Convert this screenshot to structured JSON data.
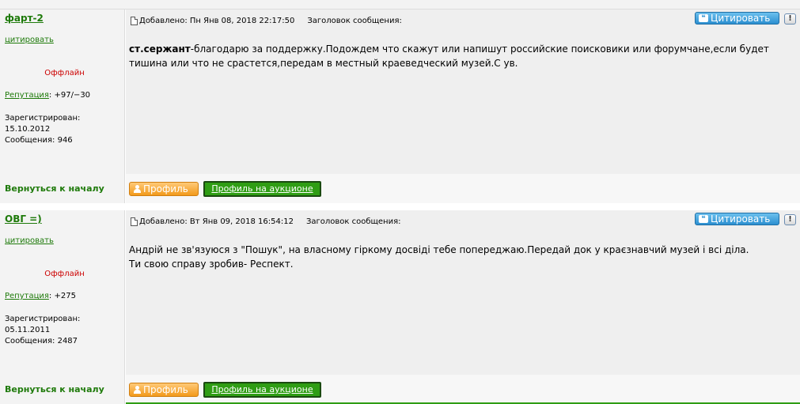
{
  "common": {
    "added_label": "Добавлено:",
    "subject_label": "Заголовок сообщения:",
    "quote_link": "цитировать",
    "cite_button": "Цитировать",
    "report_button": "!",
    "reputation_label": "Репутация",
    "registered_label": "Зарегистрирован:",
    "messages_label": "Сообщения:",
    "back_to_top": "Вернуться к началу",
    "profile_button": "Профиль",
    "auction_button": "Профиль на аукционе"
  },
  "posts": [
    {
      "username": "фарт-2",
      "status": "Оффлайн",
      "reputation": ": +97/−30",
      "registered_date": "15.10.2012",
      "messages_count": "946",
      "added_date": "Пн Янв 08, 2018 22:17:50",
      "message_bold": "ст.сержант",
      "message_text": "-благодарю за поддержку.Подождем что скажут или напишут российские поисковики или форумчане,если будет тишина или что не срастется,передам в местный краеведческий музей.С ув."
    },
    {
      "username": "ОВГ =)",
      "status": "Оффлайн",
      "reputation": ": +275",
      "registered_date": "05.11.2011",
      "messages_count": "2487",
      "added_date": "Вт Янв 09, 2018 16:54:12",
      "message_line1": "Андрій не зв'язуюся з \"Пошук\", на власному гіркому досвіді тебе попереджаю.Передай док у краєзнавчий музей і всі діла.",
      "message_line2": "Ти свою справу зробив- Респект."
    }
  ]
}
